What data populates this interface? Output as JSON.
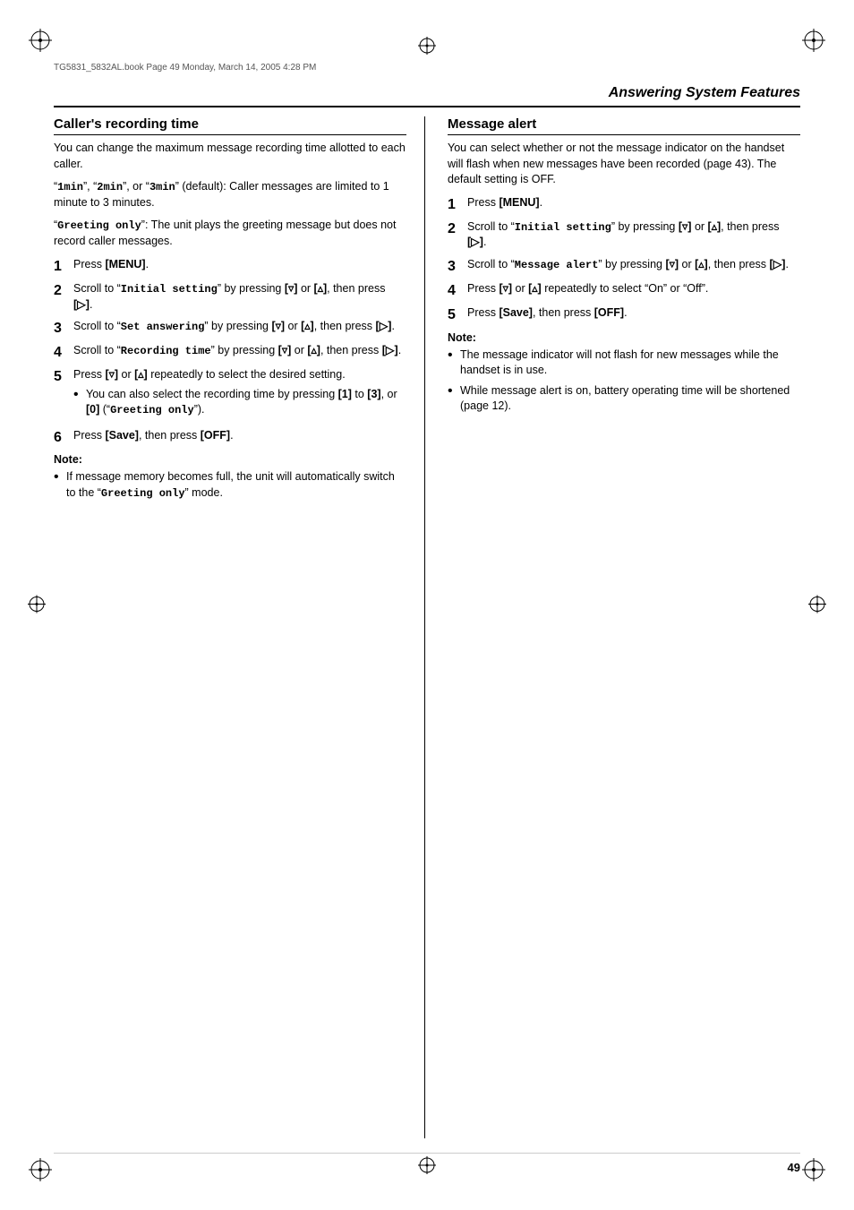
{
  "page": {
    "title": "Answering System Features",
    "page_number": "49",
    "header_text": "TG5831_5832AL.book  Page 49  Monday, March 14, 2005  4:28 PM"
  },
  "left_section": {
    "title": "Caller's recording time",
    "intro": "You can change the maximum message recording time allotted to each caller.",
    "description1": "“1min”, “2min”, or “3min” (default): Caller messages are limited to 1 minute to 3 minutes.",
    "description2": "“Greeting only”: The unit plays the greeting message but does not record caller messages.",
    "steps": [
      {
        "number": "1",
        "text": "Press [MENU]."
      },
      {
        "number": "2",
        "text": "Scroll to “Initial setting” by pressing [▿] or [▴], then press [►]."
      },
      {
        "number": "3",
        "text": "Scroll to “Set answering” by pressing [▿] or [▴], then press [►]."
      },
      {
        "number": "4",
        "text": "Scroll to “Recording time” by pressing [▿] or [▴], then press [►]."
      },
      {
        "number": "5",
        "text": "Press [▿] or [▴] repeatedly to select the desired setting.",
        "subnote": "You can also select the recording time by pressing [1] to [3], or [0] (“Greeting only”)."
      },
      {
        "number": "6",
        "text": "Press [Save], then press [OFF]."
      }
    ],
    "note_title": "Note:",
    "notes": [
      "If message memory becomes full, the unit will automatically switch to the “Greeting only” mode."
    ]
  },
  "right_section": {
    "title": "Message alert",
    "intro": "You can select whether or not the message indicator on the handset will flash when new messages have been recorded (page 43). The default setting is OFF.",
    "steps": [
      {
        "number": "1",
        "text": "Press [MENU]."
      },
      {
        "number": "2",
        "text": "Scroll to “Initial setting” by pressing [▿] or [▴], then press [►]."
      },
      {
        "number": "3",
        "text": "Scroll to “Message alert” by pressing [▿] or [▴], then press [►]."
      },
      {
        "number": "4",
        "text": "Press [▿] or [▴] repeatedly to select “On” or “Off”."
      },
      {
        "number": "5",
        "text": "Press [Save], then press [OFF]."
      }
    ],
    "note_title": "Note:",
    "notes": [
      "The message indicator will not flash for new messages while the handset is in use.",
      "While message alert is on, battery operating time will be shortened (page 12)."
    ]
  }
}
